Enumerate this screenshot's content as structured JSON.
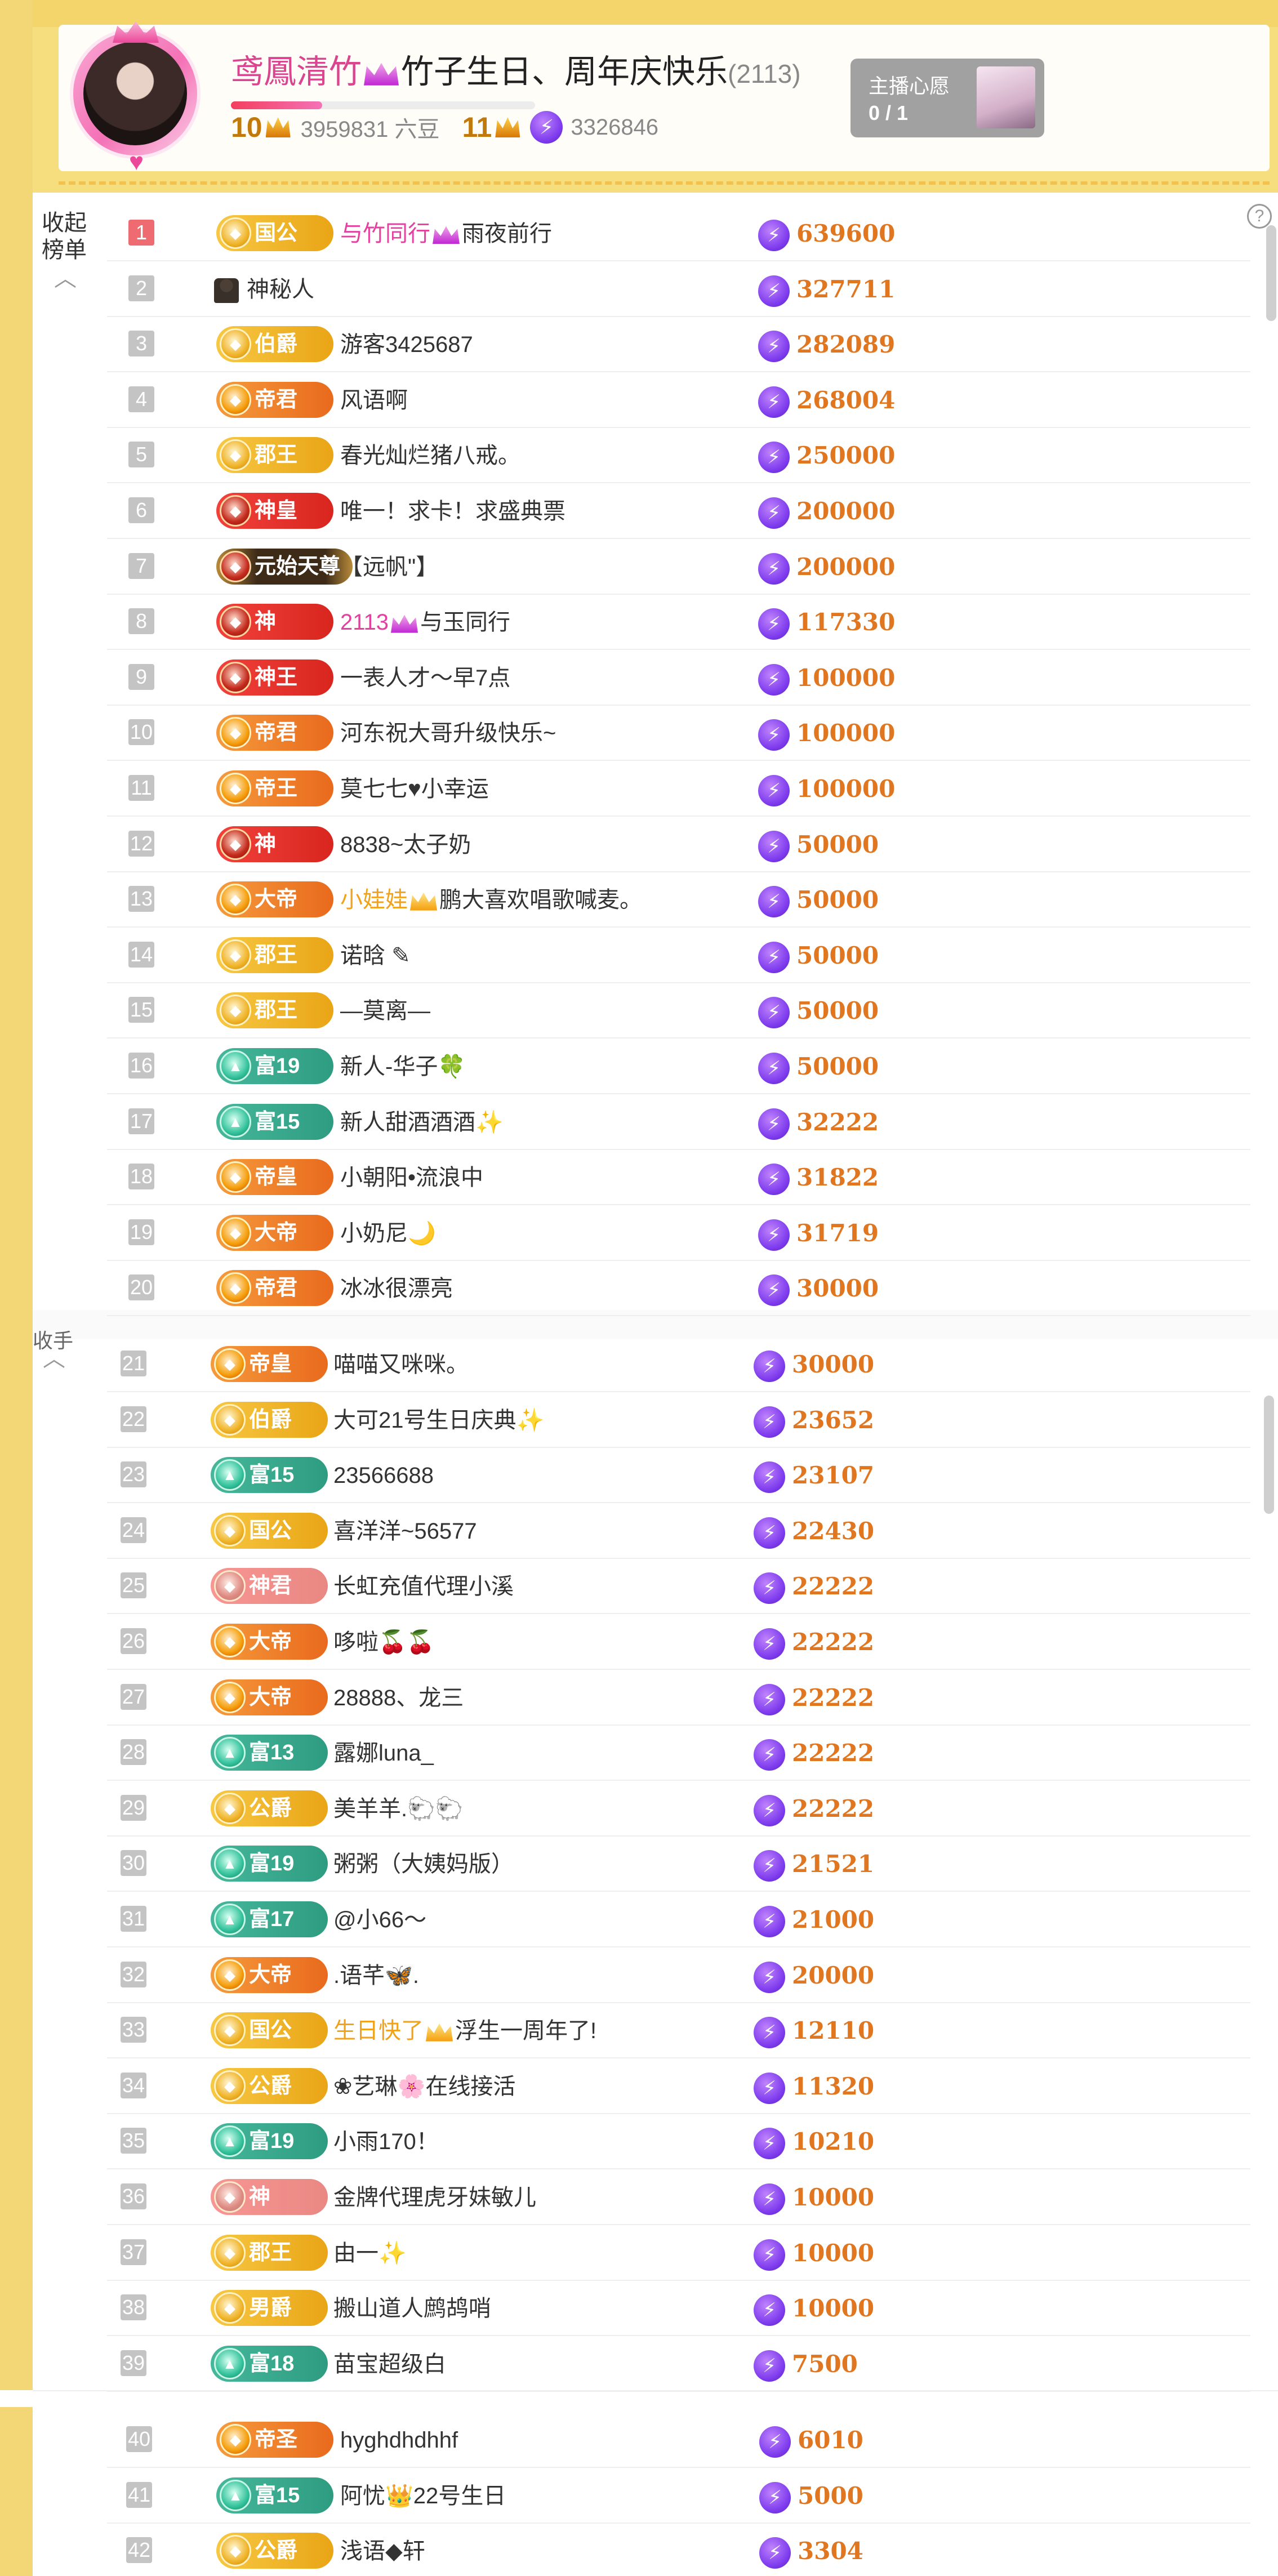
{
  "header": {
    "anchor_name": "鸢鳳清竹",
    "room_title": "竹子生日、周年庆快乐",
    "room_count": "(2113)",
    "level_left": "10",
    "beans": "3959831 六豆",
    "level_right": "11",
    "coins": "3326846",
    "progress_percent": 30,
    "wish": {
      "label": "主播心愿",
      "count": "0 / 1"
    }
  },
  "panel": {
    "collapse_label": "收起\n榜单",
    "help_icon": "?",
    "side_fragment": "收手"
  },
  "colors": {
    "accent_amount": "#e0761f",
    "rank_top": "#ef6b72",
    "pink_name": "#e3409f"
  },
  "ranking": [
    {
      "rank": "1",
      "badge": "国公",
      "badge_style": "gold",
      "name_pre": "与竹同行",
      "name_pre_color": "pink",
      "crown": true,
      "name": "雨夜前行",
      "amount": "639600"
    },
    {
      "rank": "2",
      "badge": "",
      "badge_style": "none",
      "name": "神秘人",
      "mystery": true,
      "amount": "327711"
    },
    {
      "rank": "3",
      "badge": "伯爵",
      "badge_style": "gold",
      "name": "游客3425687",
      "amount": "282089"
    },
    {
      "rank": "4",
      "badge": "帝君",
      "badge_style": "orange",
      "name": "风语啊",
      "amount": "268004"
    },
    {
      "rank": "5",
      "badge": "郡王",
      "badge_style": "gold",
      "name": "春光灿烂猪八戒。",
      "amount": "250000"
    },
    {
      "rank": "6",
      "badge": "神皇",
      "badge_style": "red",
      "name": "唯一！求卡！求盛典票",
      "amount": "200000"
    },
    {
      "rank": "7",
      "badge": "元始天尊",
      "badge_style": "dark",
      "name": "【远帆\"】",
      "amount": "200000"
    },
    {
      "rank": "8",
      "badge": "神",
      "badge_style": "red",
      "name_pre": "2113",
      "name_pre_color": "pink",
      "crown": true,
      "name": "与玉同行",
      "amount": "117330"
    },
    {
      "rank": "9",
      "badge": "神王",
      "badge_style": "red",
      "name": "一表人才～早7点",
      "amount": "100000"
    },
    {
      "rank": "10",
      "badge": "帝君",
      "badge_style": "orange",
      "name": "河东祝大哥升级快乐~",
      "amount": "100000"
    },
    {
      "rank": "11",
      "badge": "帝王",
      "badge_style": "orange",
      "name": "莫七七♥小幸运",
      "amount": "100000"
    },
    {
      "rank": "12",
      "badge": "神",
      "badge_style": "red",
      "name": "8838~太子奶",
      "amount": "50000"
    },
    {
      "rank": "13",
      "badge": "大帝",
      "badge_style": "orange",
      "name_pre": "小娃娃",
      "name_pre_color": "amber",
      "crown": true,
      "name": "鹏大喜欢唱歌喊麦。",
      "amount": "50000"
    },
    {
      "rank": "14",
      "badge": "郡王",
      "badge_style": "gold",
      "name": "诺晗 ✎",
      "amount": "50000"
    },
    {
      "rank": "15",
      "badge": "郡王",
      "badge_style": "gold",
      "name": "—莫离—",
      "amount": "50000"
    },
    {
      "rank": "16",
      "badge": "富19",
      "badge_style": "teal",
      "name": "新人-华子🍀",
      "amount": "50000"
    },
    {
      "rank": "17",
      "badge": "富15",
      "badge_style": "teal",
      "name": "新人甜酒酒酒✨",
      "amount": "32222"
    },
    {
      "rank": "18",
      "badge": "帝皇",
      "badge_style": "orange",
      "name": "小朝阳•流浪中",
      "amount": "31822"
    },
    {
      "rank": "19",
      "badge": "大帝",
      "badge_style": "orange",
      "name": "小奶尼🌙",
      "amount": "31719"
    },
    {
      "rank": "20",
      "badge": "帝君",
      "badge_style": "orange",
      "name": "冰冰很漂亮",
      "amount": "30000"
    },
    {
      "rank": "21",
      "badge": "帝皇",
      "badge_style": "orange",
      "name": "喵喵又咪咪。",
      "amount": "30000"
    },
    {
      "rank": "22",
      "badge": "伯爵",
      "badge_style": "gold",
      "name": "大可21号生日庆典✨",
      "amount": "23652"
    },
    {
      "rank": "23",
      "badge": "富15",
      "badge_style": "teal",
      "name": "23566688",
      "amount": "23107"
    },
    {
      "rank": "24",
      "badge": "国公",
      "badge_style": "gold",
      "name": "喜洋洋~56577",
      "amount": "22430"
    },
    {
      "rank": "25",
      "badge": "神君",
      "badge_style": "red_faded",
      "name": "长虹充值代理小溪",
      "amount": "22222"
    },
    {
      "rank": "26",
      "badge": "大帝",
      "badge_style": "orange",
      "name": "哆啦🍒🍒",
      "amount": "22222"
    },
    {
      "rank": "27",
      "badge": "大帝",
      "badge_style": "orange",
      "name": "28888、龙三",
      "amount": "22222"
    },
    {
      "rank": "28",
      "badge": "富13",
      "badge_style": "teal",
      "name": "露娜luna_",
      "amount": "22222"
    },
    {
      "rank": "29",
      "badge": "公爵",
      "badge_style": "gold",
      "name": "美羊羊.🐑🐑",
      "amount": "22222"
    },
    {
      "rank": "30",
      "badge": "富19",
      "badge_style": "teal",
      "name": "粥粥（大姨妈版）",
      "amount": "21521"
    },
    {
      "rank": "31",
      "badge": "富17",
      "badge_style": "teal",
      "name": "@小66～",
      "amount": "21000"
    },
    {
      "rank": "32",
      "badge": "大帝",
      "badge_style": "orange",
      "name": ".语芊🦋.",
      "amount": "20000"
    },
    {
      "rank": "33",
      "badge": "国公",
      "badge_style": "gold",
      "name_pre": "生日快了",
      "name_pre_color": "amber",
      "crown": true,
      "name": "浮生一周年了!",
      "amount": "12110"
    },
    {
      "rank": "34",
      "badge": "公爵",
      "badge_style": "gold",
      "name": "❀艺琳🌸在线接活",
      "amount": "11320"
    },
    {
      "rank": "35",
      "badge": "富19",
      "badge_style": "teal",
      "name": "小雨170！",
      "amount": "10210"
    },
    {
      "rank": "36",
      "badge": "神",
      "badge_style": "red_faded",
      "name": "金牌代理虎牙妹敏儿",
      "amount": "10000"
    },
    {
      "rank": "37",
      "badge": "郡王",
      "badge_style": "gold",
      "name": "由一✨",
      "amount": "10000"
    },
    {
      "rank": "38",
      "badge": "男爵",
      "badge_style": "gold",
      "name": "搬山道人鹧鸪哨",
      "amount": "10000"
    },
    {
      "rank": "39",
      "badge": "富18",
      "badge_style": "teal",
      "name": "苗宝超级白",
      "amount": "7500"
    },
    {
      "rank": "40",
      "badge": "帝圣",
      "badge_style": "orange",
      "name": "hyghdhdhhf",
      "amount": "6010"
    },
    {
      "rank": "41",
      "badge": "富15",
      "badge_style": "teal",
      "name": "阿忧👑22号生日",
      "amount": "5000"
    },
    {
      "rank": "42",
      "badge": "公爵",
      "badge_style": "gold",
      "name": "浅语◆轩",
      "amount": "3304"
    }
  ]
}
